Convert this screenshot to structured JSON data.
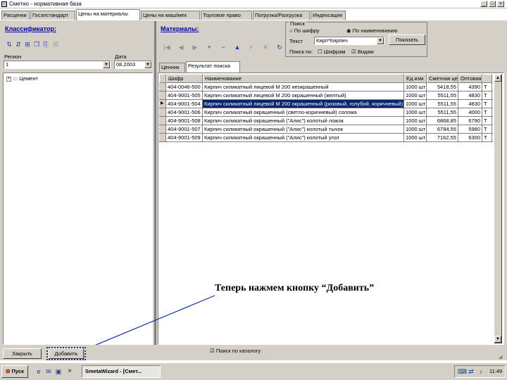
{
  "window": {
    "title": "Сметно - нормативная база"
  },
  "tabs": [
    "Расценки",
    "Госэлстандарт",
    "Цены на материалы",
    "Цены на маш/мех",
    "Торговое право",
    "Погрузка/Разгрузка",
    "Индексация"
  ],
  "classifier": {
    "header": "Классификатор:",
    "region_label": "Регион",
    "region_value": "1",
    "date_label": "Дата",
    "date_value": "08.2003",
    "tree_root": "Цемент"
  },
  "materials": {
    "header": "Материалы:",
    "subtabs": [
      "Ценник",
      "Результат поиска"
    ]
  },
  "search": {
    "group_label": "Поиск",
    "opt_cipher": "По шифру",
    "opt_name": "По наименованию",
    "text_label": "Текст",
    "text_value": "Кирп*Кирпич",
    "show_button": "Показать",
    "fields_label": "Поиск по:",
    "chk1": "Шифрам",
    "chk2": "Видам"
  },
  "grid": {
    "columns": [
      "Шифр",
      "Наименование",
      "Ед.изм",
      "Сметная цена",
      "Оптовая",
      ""
    ],
    "rows": [
      {
        "code": "404-0046-500",
        "name": "Кирпич силикатный лицевой М 200 неокрашенный",
        "unit": "1000 шт",
        "price": "5418,55",
        "wholesale": "4390",
        "mark": "T"
      },
      {
        "code": "404-9001-505",
        "name": "Кирпич силикатный лицевой М 200 окрашенный (желтый)",
        "unit": "1000 шт",
        "price": "5511,55",
        "wholesale": "4830",
        "mark": "T"
      },
      {
        "code": "404-9001-504",
        "name": "Кирпич силикатный лицевой М 200 окрашенный (розовый, голубой, коричневый)",
        "unit": "1000 шт",
        "price": "5511,55",
        "wholesale": "4830",
        "mark": "T"
      },
      {
        "code": "404-9001-506",
        "name": "Кирпич силикатный окрашенный (светло-коричневый) солома",
        "unit": "1000 шт",
        "price": "5511,55",
        "wholesale": "4000",
        "mark": "T"
      },
      {
        "code": "404-9001-508",
        "name": "Кирпич силикатный окрашенный (\"Алис\") колотый ложок",
        "unit": "1000 шт",
        "price": "6868,85",
        "wholesale": "6790",
        "mark": "T"
      },
      {
        "code": "404-9001-507",
        "name": "Кирпич силикатный окрашенный (\"Алис\") колотый тычок",
        "unit": "1000 шт",
        "price": "6784,55",
        "wholesale": "5980",
        "mark": "T"
      },
      {
        "code": "404-9001-509",
        "name": "Кирпич силикатный окрашенный (\"Алис\") колотый угол",
        "unit": "1000 шт",
        "price": "7162,55",
        "wholesale": "6300",
        "mark": "T"
      }
    ],
    "selected_index": 2
  },
  "callout": {
    "text": "Теперь нажмем кнопку “Добавить”"
  },
  "bottom": {
    "close_button": "Закрыть",
    "add_button": "Добавить",
    "checkbox_label": "Поиск по каталогу"
  },
  "taskbar": {
    "start": "Пуск",
    "task_label": "SmetaWizard - [Смет...",
    "clock": "11:49"
  },
  "colors": {
    "selection": "#0a246a",
    "callout_line": "#1a2fa0",
    "dialog_face": "#d4d0c8"
  }
}
